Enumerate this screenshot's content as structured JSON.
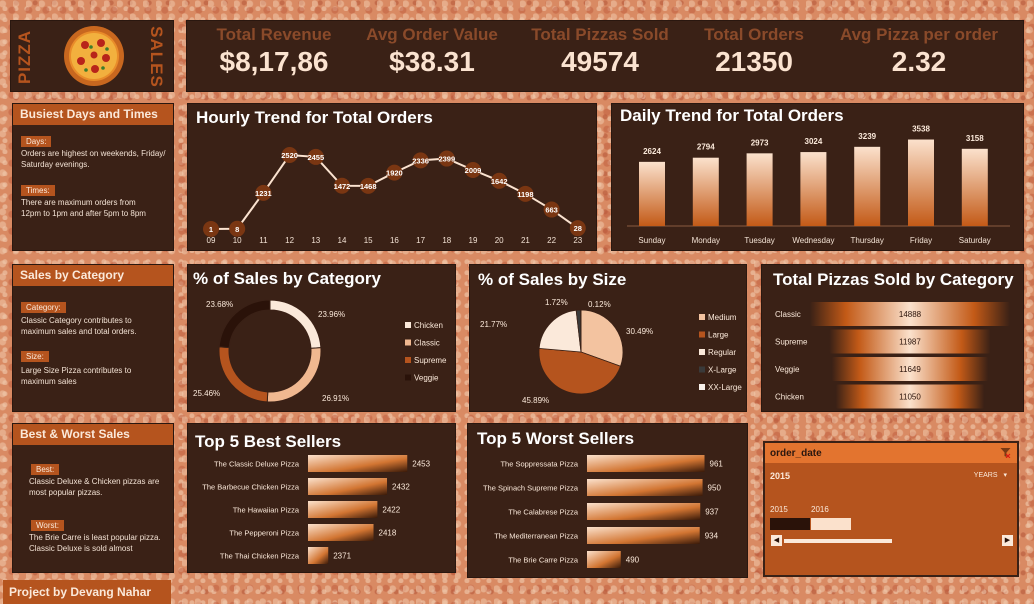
{
  "logo": {
    "left": "PIZZA",
    "right": "SALES"
  },
  "kpis": [
    {
      "label": "Total Revenue",
      "value": "$8,17,86"
    },
    {
      "label": "Avg Order Value",
      "value": "$38.31"
    },
    {
      "label": "Total Pizzas Sold",
      "value": "49574"
    },
    {
      "label": "Total Orders",
      "value": "21350"
    },
    {
      "label": "Avg Pizza per order",
      "value": "2.32"
    }
  ],
  "side": {
    "busiest": {
      "title": "Busiest Days and Times",
      "days_tag": "Days:",
      "days_text": "Orders are highest on weekends, Friday/ Saturday evenings.",
      "times_tag": "Times:",
      "times_text": "There are maximum orders from 12pm to 1pm and after 5pm to 8pm"
    },
    "category": {
      "title": "Sales by Category",
      "cat_tag": "Category:",
      "cat_text": "Classic Category contributes to maximum sales and total orders.",
      "size_tag": "Size:",
      "size_text": "Large Size Pizza contributes to maximum sales"
    },
    "bestworst": {
      "title": "Best & Worst Sales",
      "best_tag": "Best:",
      "best_text": "Classic Deluxe & Chicken pizzas are most popular pizzas.",
      "worst_tag": "Worst:",
      "worst_text": "The Brie Carre is least popular pizza. Classic Deluxe is sold almost"
    }
  },
  "footer": "Project by Devang Nahar",
  "slicer": {
    "title": "order_date",
    "selected": "2015",
    "period": "YEARS",
    "years": [
      "2015",
      "2016"
    ],
    "filter_icon": "filter-icon",
    "dropdown_icon": "chevron-down-icon"
  },
  "colors": {
    "accent": "#b5541e",
    "panel": "#3a2116",
    "bar_light": "#fbe1cc",
    "bar_dark": "#c35a17"
  },
  "chart_data": [
    {
      "id": "hourly",
      "type": "line",
      "title": "Hourly Trend for Total Orders",
      "x": [
        "09",
        "10",
        "11",
        "12",
        "13",
        "14",
        "15",
        "16",
        "17",
        "18",
        "19",
        "20",
        "21",
        "22",
        "23"
      ],
      "values": [
        1,
        8,
        1231,
        2520,
        2455,
        1472,
        1468,
        1920,
        2336,
        2399,
        2009,
        1642,
        1198,
        663,
        28
      ]
    },
    {
      "id": "daily",
      "type": "bar",
      "title": "Daily Trend for Total Orders",
      "categories": [
        "Sunday",
        "Monday",
        "Tuesday",
        "Wednesday",
        "Thursday",
        "Friday",
        "Saturday"
      ],
      "values": [
        2624,
        2794,
        2973,
        3024,
        3239,
        3538,
        3158
      ]
    },
    {
      "id": "category",
      "type": "pie",
      "title": "% of Sales by Category",
      "categories": [
        "Chicken",
        "Classic",
        "Supreme",
        "Veggie"
      ],
      "values": [
        23.96,
        26.91,
        25.46,
        23.68
      ],
      "labels": [
        "23.96%",
        "26.91%",
        "25.46%",
        "23.68%"
      ],
      "colors": [
        "#fbe9da",
        "#f0b890",
        "#b5541e",
        "#2a1209"
      ]
    },
    {
      "id": "size",
      "type": "pie",
      "title": "% of Sales by Size",
      "categories": [
        "Medium",
        "Large",
        "Regular",
        "X-Large",
        "XX-Large"
      ],
      "values": [
        30.49,
        45.89,
        21.77,
        1.72,
        0.12
      ],
      "labels": [
        "30.49%",
        "45.89%",
        "21.77%",
        "1.72%",
        "0.12%"
      ],
      "colors": [
        "#f3c3a0",
        "#b5541e",
        "#fbe9da",
        "#3a3a3a",
        "#f7f0ea"
      ]
    },
    {
      "id": "pizzas_by_category",
      "type": "bar",
      "title": "Total Pizzas Sold by Category",
      "categories": [
        "Classic",
        "Supreme",
        "Veggie",
        "Chicken"
      ],
      "values": [
        14888,
        11987,
        11649,
        11050
      ]
    },
    {
      "id": "best",
      "type": "bar",
      "title": "Top 5 Best Sellers",
      "categories": [
        "The Classic Deluxe Pizza",
        "The Barbecue Chicken Pizza",
        "The Hawaiian Pizza",
        "The Pepperoni Pizza",
        "The Thai Chicken Pizza"
      ],
      "values": [
        2453,
        2432,
        2422,
        2418,
        2371
      ]
    },
    {
      "id": "worst",
      "type": "bar",
      "title": "Top 5 Worst Sellers",
      "categories": [
        "The Soppressata Pizza",
        "The Spinach Supreme Pizza",
        "The Calabrese Pizza",
        "The Mediterranean Pizza",
        "The Brie Carre Pizza"
      ],
      "values": [
        961,
        950,
        937,
        934,
        490
      ]
    }
  ]
}
